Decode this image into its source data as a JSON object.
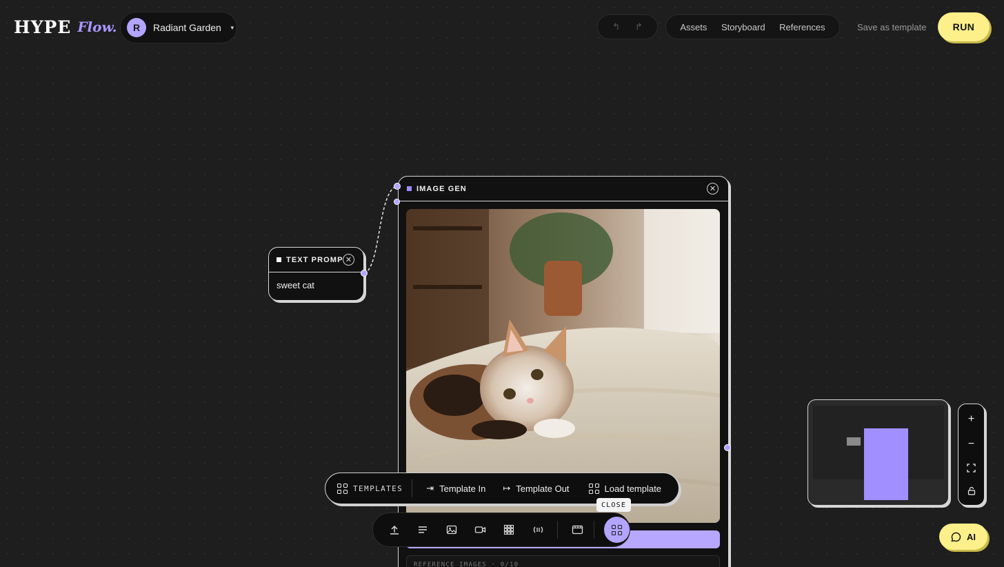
{
  "header": {
    "logo_text": "HYPE",
    "logo_flow": "Flow.",
    "project": {
      "avatar_initial": "R",
      "name": "Radiant Garden"
    },
    "undo_label": "↰",
    "redo_label": "↱",
    "nav": [
      "Assets",
      "Storyboard",
      "References"
    ],
    "save_template_label": "Save as template",
    "run_label": "RUN"
  },
  "canvas": {
    "text_prompt_node": {
      "title": "TEXT PROMPT",
      "content": "sweet cat"
    },
    "image_gen_node": {
      "title": "IMAGE GEN",
      "reference_label": "REFERENCE IMAGES · 0/10"
    }
  },
  "templates_toolbar": {
    "label": "TEMPLATES",
    "items": [
      "Template In",
      "Template Out",
      "Load template"
    ],
    "tooltip": "CLOSE"
  },
  "dock": {
    "tools": [
      "upload-icon",
      "text-icon",
      "image-icon",
      "video-icon",
      "grid-icon",
      "audio-icon",
      "storyboard-icon",
      "templates-icon"
    ]
  },
  "zoom_controls": [
    "+",
    "−",
    "fit",
    "lock"
  ],
  "ai_button_label": "AI",
  "colors": {
    "accent_purple": "#b3a4ff",
    "accent_yellow": "#fdf08a",
    "background": "#1e1e1e"
  }
}
